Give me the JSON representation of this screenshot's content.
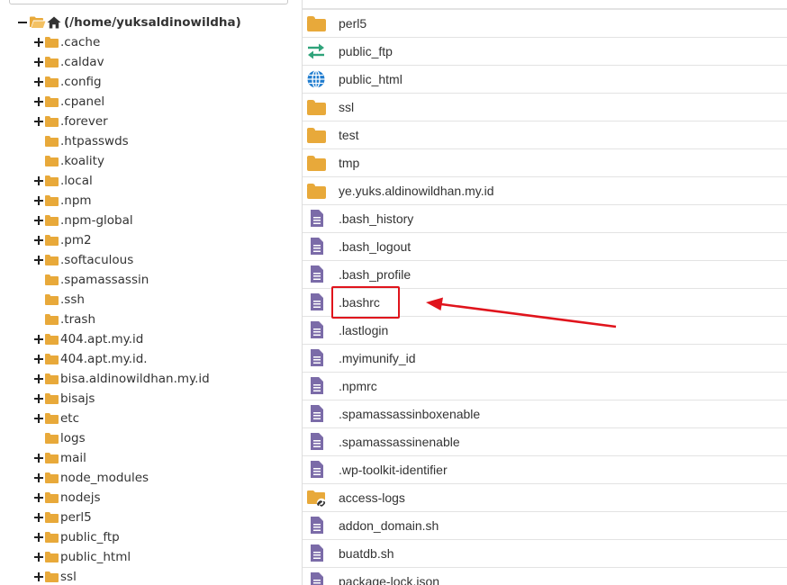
{
  "tree": {
    "root": {
      "label": "(/home/yuksaldinowildha)",
      "expanded": true
    },
    "items": [
      {
        "label": ".cache",
        "expandable": true
      },
      {
        "label": ".caldav",
        "expandable": true
      },
      {
        "label": ".config",
        "expandable": true
      },
      {
        "label": ".cpanel",
        "expandable": true
      },
      {
        "label": ".forever",
        "expandable": true
      },
      {
        "label": ".htpasswds",
        "expandable": false
      },
      {
        "label": ".koality",
        "expandable": false
      },
      {
        "label": ".local",
        "expandable": true
      },
      {
        "label": ".npm",
        "expandable": true
      },
      {
        "label": ".npm-global",
        "expandable": true
      },
      {
        "label": ".pm2",
        "expandable": true
      },
      {
        "label": ".softaculous",
        "expandable": true
      },
      {
        "label": ".spamassassin",
        "expandable": false
      },
      {
        "label": ".ssh",
        "expandable": false
      },
      {
        "label": ".trash",
        "expandable": false
      },
      {
        "label": "404.apt.my.id",
        "expandable": true
      },
      {
        "label": "404.apt.my.id.",
        "expandable": true
      },
      {
        "label": "bisa.aldinowildhan.my.id",
        "expandable": true
      },
      {
        "label": "bisajs",
        "expandable": true
      },
      {
        "label": "etc",
        "expandable": true
      },
      {
        "label": "logs",
        "expandable": false
      },
      {
        "label": "mail",
        "expandable": true
      },
      {
        "label": "node_modules",
        "expandable": true
      },
      {
        "label": "nodejs",
        "expandable": true
      },
      {
        "label": "perl5",
        "expandable": true
      },
      {
        "label": "public_ftp",
        "expandable": true
      },
      {
        "label": "public_html",
        "expandable": true
      },
      {
        "label": "ssl",
        "expandable": true
      }
    ]
  },
  "files": [
    {
      "name": "perl5",
      "icon": "folder-icon"
    },
    {
      "name": "public_ftp",
      "icon": "transfer-arrows-icon"
    },
    {
      "name": "public_html",
      "icon": "globe-icon"
    },
    {
      "name": "ssl",
      "icon": "folder-icon"
    },
    {
      "name": "test",
      "icon": "folder-icon"
    },
    {
      "name": "tmp",
      "icon": "folder-icon"
    },
    {
      "name": "ye.yuks.aldinowildhan.my.id",
      "icon": "folder-icon"
    },
    {
      "name": ".bash_history",
      "icon": "document-icon"
    },
    {
      "name": ".bash_logout",
      "icon": "document-icon"
    },
    {
      "name": ".bash_profile",
      "icon": "document-icon"
    },
    {
      "name": ".bashrc",
      "icon": "document-icon"
    },
    {
      "name": ".lastlogin",
      "icon": "document-icon"
    },
    {
      "name": ".myimunify_id",
      "icon": "document-icon"
    },
    {
      "name": ".npmrc",
      "icon": "document-icon"
    },
    {
      "name": ".spamassassinboxenable",
      "icon": "document-icon"
    },
    {
      "name": ".spamassassinenable",
      "icon": "document-icon"
    },
    {
      "name": ".wp-toolkit-identifier",
      "icon": "document-icon"
    },
    {
      "name": "access-logs",
      "icon": "folder-link-icon"
    },
    {
      "name": "addon_domain.sh",
      "icon": "document-icon"
    },
    {
      "name": "buatdb.sh",
      "icon": "document-icon"
    },
    {
      "name": "package-lock.json",
      "icon": "document-icon"
    }
  ],
  "annotation": {
    "highlighted_file": ".bashrc",
    "color": "#e0141c"
  },
  "colors": {
    "folder": "#e8a93a",
    "document": "#7b6ba8",
    "transfer": "#2fa37a",
    "globe": "#1f7ccf"
  }
}
